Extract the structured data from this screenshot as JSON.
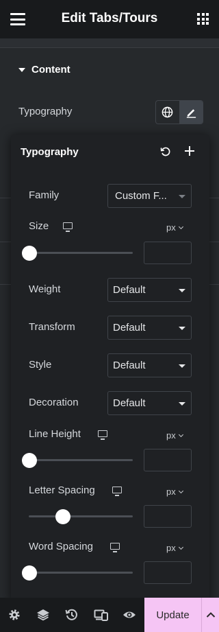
{
  "header": {
    "title": "Edit Tabs/Tours",
    "menu_icon": "hamburger-icon",
    "grid_icon": "apps-grid-icon"
  },
  "section": {
    "title": "Content"
  },
  "typography_row": {
    "label": "Typography",
    "buttons": [
      "globe-icon",
      "pencil-icon"
    ]
  },
  "popover": {
    "title": "Typography",
    "icons": [
      "reset-icon",
      "plus-icon"
    ],
    "family": {
      "label": "Family",
      "value": "Custom F..."
    },
    "size": {
      "label": "Size",
      "unit": "px",
      "slider_value_fraction": 0.0,
      "input_value": ""
    },
    "weight": {
      "label": "Weight",
      "value": "Default"
    },
    "transform": {
      "label": "Transform",
      "value": "Default"
    },
    "style": {
      "label": "Style",
      "value": "Default"
    },
    "decoration": {
      "label": "Decoration",
      "value": "Default"
    },
    "line_height": {
      "label": "Line Height",
      "unit": "px",
      "slider_value_fraction": 0.0,
      "input_value": ""
    },
    "letter_spacing": {
      "label": "Letter Spacing",
      "unit": "px",
      "slider_value_fraction": 0.33,
      "input_value": ""
    },
    "word_spacing": {
      "label": "Word Spacing",
      "unit": "px",
      "slider_value_fraction": 0.0,
      "input_value": ""
    }
  },
  "footer": {
    "icons": [
      "settings-icon",
      "layers-icon",
      "history-icon",
      "responsive-icon",
      "preview-eye-icon"
    ],
    "update_label": "Update",
    "more_icon": "chevron-up-icon"
  },
  "colors": {
    "accent": "#f5c5f4",
    "panel": "#1f2124",
    "background": "#26292c"
  }
}
